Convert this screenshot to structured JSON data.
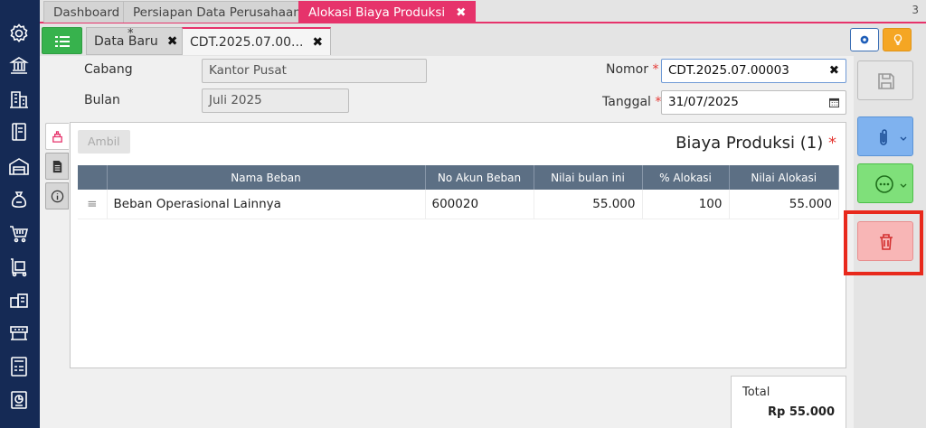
{
  "top_tabs": [
    {
      "label": "Dashboard"
    },
    {
      "label": "Persiapan Data Perusahaan"
    },
    {
      "label": "Alokasi Biaya Produksi",
      "close": "✖"
    }
  ],
  "tab_count": "3",
  "sub_tabs": [
    {
      "label": "Data Baru",
      "close": "✖",
      "marker": "*"
    },
    {
      "label": "CDT.2025.07.00...",
      "close": "✖"
    }
  ],
  "form": {
    "cabang_label": "Cabang",
    "cabang_value": "Kantor Pusat",
    "bulan_label": "Bulan",
    "bulan_value": "Juli 2025",
    "nomor_label": "Nomor",
    "nomor_value": "CDT.2025.07.00003",
    "nomor_clear": "✖",
    "tanggal_label": "Tanggal",
    "tanggal_value": "31/07/2025",
    "required_mark": "*"
  },
  "detail": {
    "ambil_label": "Ambil",
    "title": "Biaya Produksi (1)",
    "required_mark": "*",
    "columns": [
      "Nama Beban",
      "No Akun Beban",
      "Nilai bulan ini",
      "% Alokasi",
      "Nilai Alokasi"
    ],
    "rows": [
      {
        "handle": "≡",
        "nama": "Beban Operasional Lainnya",
        "akun": "600020",
        "nilai": "55.000",
        "alokasi": "100",
        "nilai_alokasi": "55.000"
      }
    ]
  },
  "total": {
    "label": "Total",
    "value": "Rp 55.000"
  },
  "colors": {
    "accent": "#e6336b",
    "sidebar": "#152a55",
    "header": "#5c6f84",
    "highlight": "#e8291c"
  }
}
